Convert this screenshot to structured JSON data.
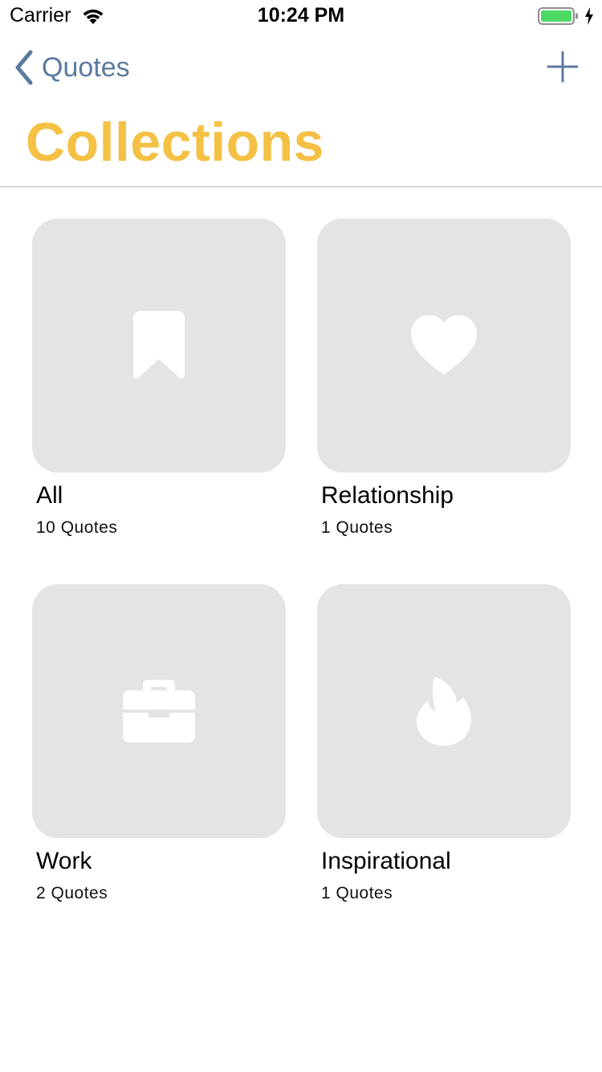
{
  "status_bar": {
    "carrier": "Carrier",
    "time": "10:24 PM",
    "icons": [
      "wifi-icon",
      "battery-icon",
      "charging-icon"
    ],
    "battery_color": "#4cd964"
  },
  "nav": {
    "back_label": "Quotes",
    "back_icon": "chevron-left-icon",
    "add_icon": "plus-icon",
    "accent_color": "#5b7a9e"
  },
  "title": "Collections",
  "title_color": "#f4c144",
  "collections": [
    {
      "name": "All",
      "count": "10 Quotes",
      "icon": "bookmark-icon"
    },
    {
      "name": "Relationship",
      "count": "1 Quotes",
      "icon": "heart-icon"
    },
    {
      "name": "Work",
      "count": "2 Quotes",
      "icon": "briefcase-icon"
    },
    {
      "name": "Inspirational",
      "count": "1 Quotes",
      "icon": "flame-icon"
    }
  ],
  "tile_color": "#e6e3e3"
}
